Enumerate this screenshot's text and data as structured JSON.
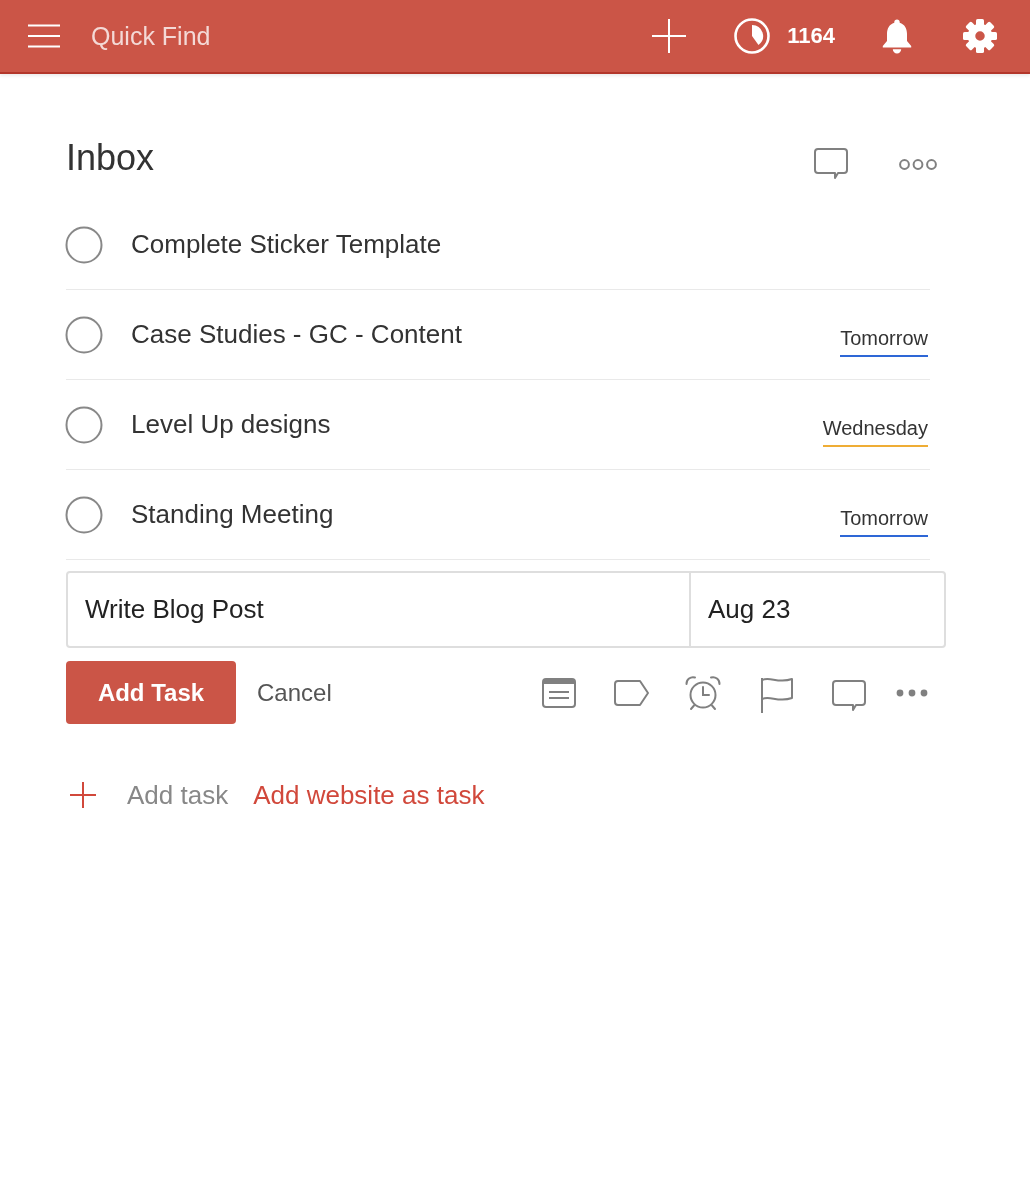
{
  "header": {
    "search": {
      "placeholder": "Quick Find"
    },
    "karma": "1164"
  },
  "page": {
    "title": "Inbox"
  },
  "tasks": [
    {
      "title": "Complete Sticker Template",
      "checked": false
    },
    {
      "title": "Case Studies - GC - Content",
      "checked": false,
      "due": {
        "label": "Tomorrow",
        "color": "#2e67d6"
      }
    },
    {
      "title": "Level Up designs",
      "checked": false,
      "due": {
        "label": "Wednesday",
        "color": "#efad35"
      }
    },
    {
      "title": "Standing Meeting",
      "checked": false,
      "due": {
        "label": "Tomorrow",
        "color": "#2e67d6"
      }
    }
  ],
  "task_editor": {
    "name": {
      "value": "Write Blog Post"
    },
    "date": {
      "value": "Aug 23"
    },
    "submit": "Add Task",
    "cancel": "Cancel"
  },
  "add_task": {
    "label": "Add task"
  },
  "add_website": {
    "label": "Add website as task"
  }
}
